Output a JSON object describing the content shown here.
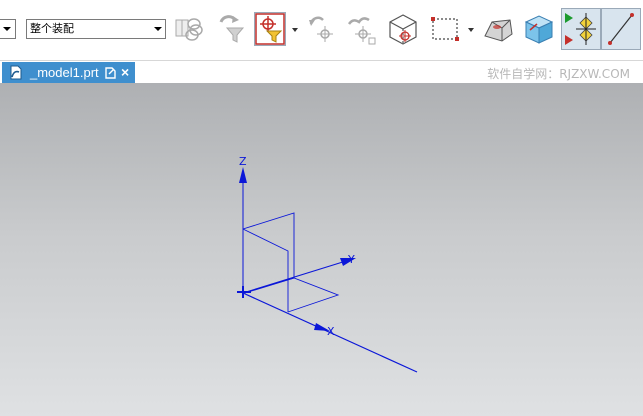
{
  "toolbar": {
    "left_select_value": "",
    "filter_select_value": "整个装配"
  },
  "tab": {
    "filename": "_model1.prt",
    "close_glyph": "×"
  },
  "watermark": "软件自学网：RJZXW.COM",
  "axes": {
    "x_label": "X",
    "y_label": "Y",
    "z_label": "Z"
  },
  "colors": {
    "tab_active": "#3f8fce",
    "axis": "#0b17d8",
    "viewport_top": "#aeb0b3",
    "viewport_bottom": "#dfe1e3"
  }
}
